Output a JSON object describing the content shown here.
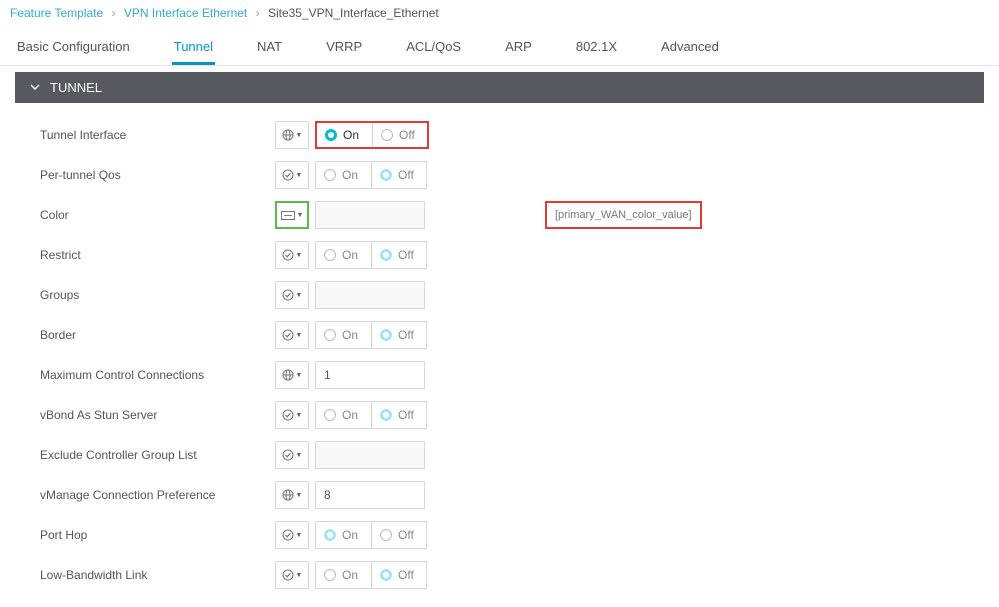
{
  "breadcrumb": {
    "a": "Feature Template",
    "b": "VPN Interface Ethernet",
    "current": "Site35_VPN_Interface_Ethernet"
  },
  "tabs": [
    "Basic Configuration",
    "Tunnel",
    "NAT",
    "VRRP",
    "ACL/QoS",
    "ARP",
    "802.1X",
    "Advanced"
  ],
  "active_tab": 1,
  "section": "TUNNEL",
  "labels": {
    "on": "On",
    "off": "Off"
  },
  "color_hint": "[primary_WAN_color_value]",
  "rows": [
    {
      "key": "tunnel_interface",
      "label": "Tunnel Interface",
      "icon": "globe",
      "kind": "onoff",
      "sel": "on",
      "strong": true,
      "red": true
    },
    {
      "key": "per_tunnel_qos",
      "label": "Per-tunnel Qos",
      "icon": "check",
      "kind": "onoff",
      "sel": "off",
      "strong": false
    },
    {
      "key": "color",
      "label": "Color",
      "icon": "box",
      "kind": "color",
      "green": true
    },
    {
      "key": "restrict",
      "label": "Restrict",
      "icon": "check",
      "kind": "onoff",
      "sel": "off",
      "strong": false
    },
    {
      "key": "groups",
      "label": "Groups",
      "icon": "check",
      "kind": "value",
      "value": ""
    },
    {
      "key": "border",
      "label": "Border",
      "icon": "check",
      "kind": "onoff",
      "sel": "off",
      "strong": false
    },
    {
      "key": "max_ctrl",
      "label": "Maximum Control Connections",
      "icon": "globe",
      "kind": "value",
      "value": "1",
      "white": true
    },
    {
      "key": "vbond_stun",
      "label": "vBond As Stun Server",
      "icon": "check",
      "kind": "onoff",
      "sel": "off",
      "strong": false
    },
    {
      "key": "exclude_ctrl",
      "label": "Exclude Controller Group List",
      "icon": "check",
      "kind": "value",
      "value": ""
    },
    {
      "key": "vmanage_pref",
      "label": "vManage Connection Preference",
      "icon": "globe",
      "kind": "value",
      "value": "8",
      "white": true
    },
    {
      "key": "port_hop",
      "label": "Port Hop",
      "icon": "check",
      "kind": "onoff",
      "sel": "on",
      "strong": false
    },
    {
      "key": "low_bw",
      "label": "Low-Bandwidth Link",
      "icon": "check",
      "kind": "onoff",
      "sel": "off",
      "strong": false
    }
  ]
}
